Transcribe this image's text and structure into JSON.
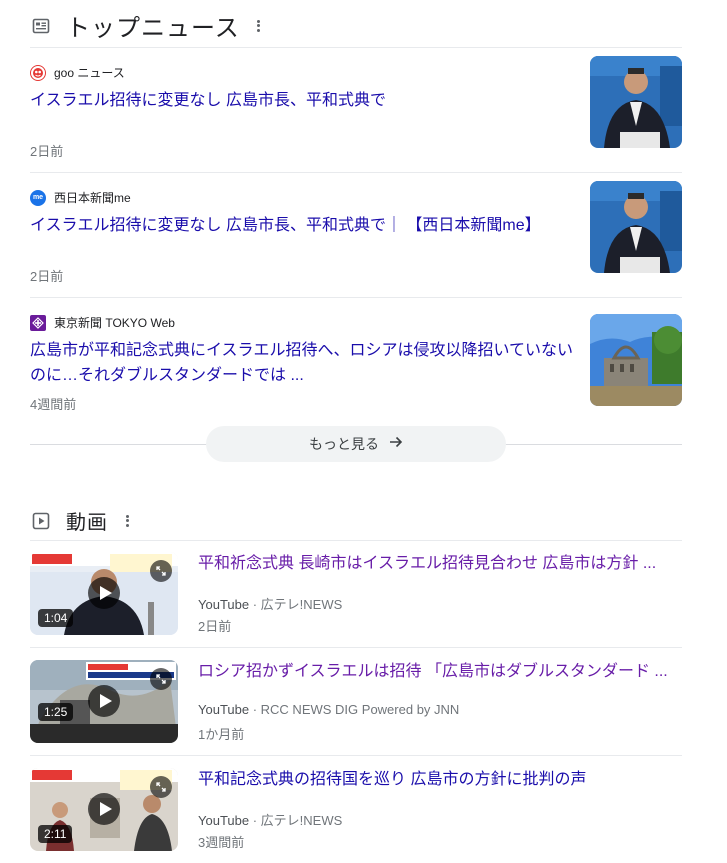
{
  "top_news": {
    "title": "トップニュース",
    "icon": "newspaper-icon",
    "items": [
      {
        "source": "goo ニュース",
        "favicon_color": "#e53935",
        "title": "イスラエル招待に変更なし 広島市長、平和式典で",
        "time": "2日前"
      },
      {
        "source": "西日本新聞me",
        "favicon_color": "#1a73e8",
        "favicon_text": "me",
        "title": "イスラエル招待に変更なし 広島市長、平和式典で｜ 【西日本新聞me】",
        "time": "2日前"
      },
      {
        "source": "東京新聞 TOKYO Web",
        "favicon_color": "#6a1b9a",
        "title": "広島市が平和記念式典にイスラエル招待へ、ロシアは侵攻以降招いていないのに…それダブルスタンダードでは ...",
        "time": "4週間前"
      }
    ],
    "more_label": "もっと見る"
  },
  "videos": {
    "title": "動画",
    "icon": "play-box-icon",
    "items": [
      {
        "title": "平和祈念式典 長崎市はイスラエル招待見合わせ 広島市は方針 ...",
        "platform": "YouTube",
        "channel": "広テレ!NEWS",
        "time": "2日前",
        "duration": "1:04"
      },
      {
        "title": "ロシア招かずイスラエルは招待 「広島市はダブルスタンダード ...",
        "platform": "YouTube",
        "channel": "RCC NEWS DIG Powered by JNN",
        "time": "1か月前",
        "duration": "1:25"
      },
      {
        "title": "平和記念式典の招待国を巡り 広島市の方針に批判の声",
        "platform": "YouTube",
        "channel": "広テレ!NEWS",
        "time": "3週間前",
        "duration": "2:11"
      }
    ]
  },
  "colors": {
    "link": "#1a0dab",
    "visited": "#681da8",
    "muted": "#70757a"
  }
}
